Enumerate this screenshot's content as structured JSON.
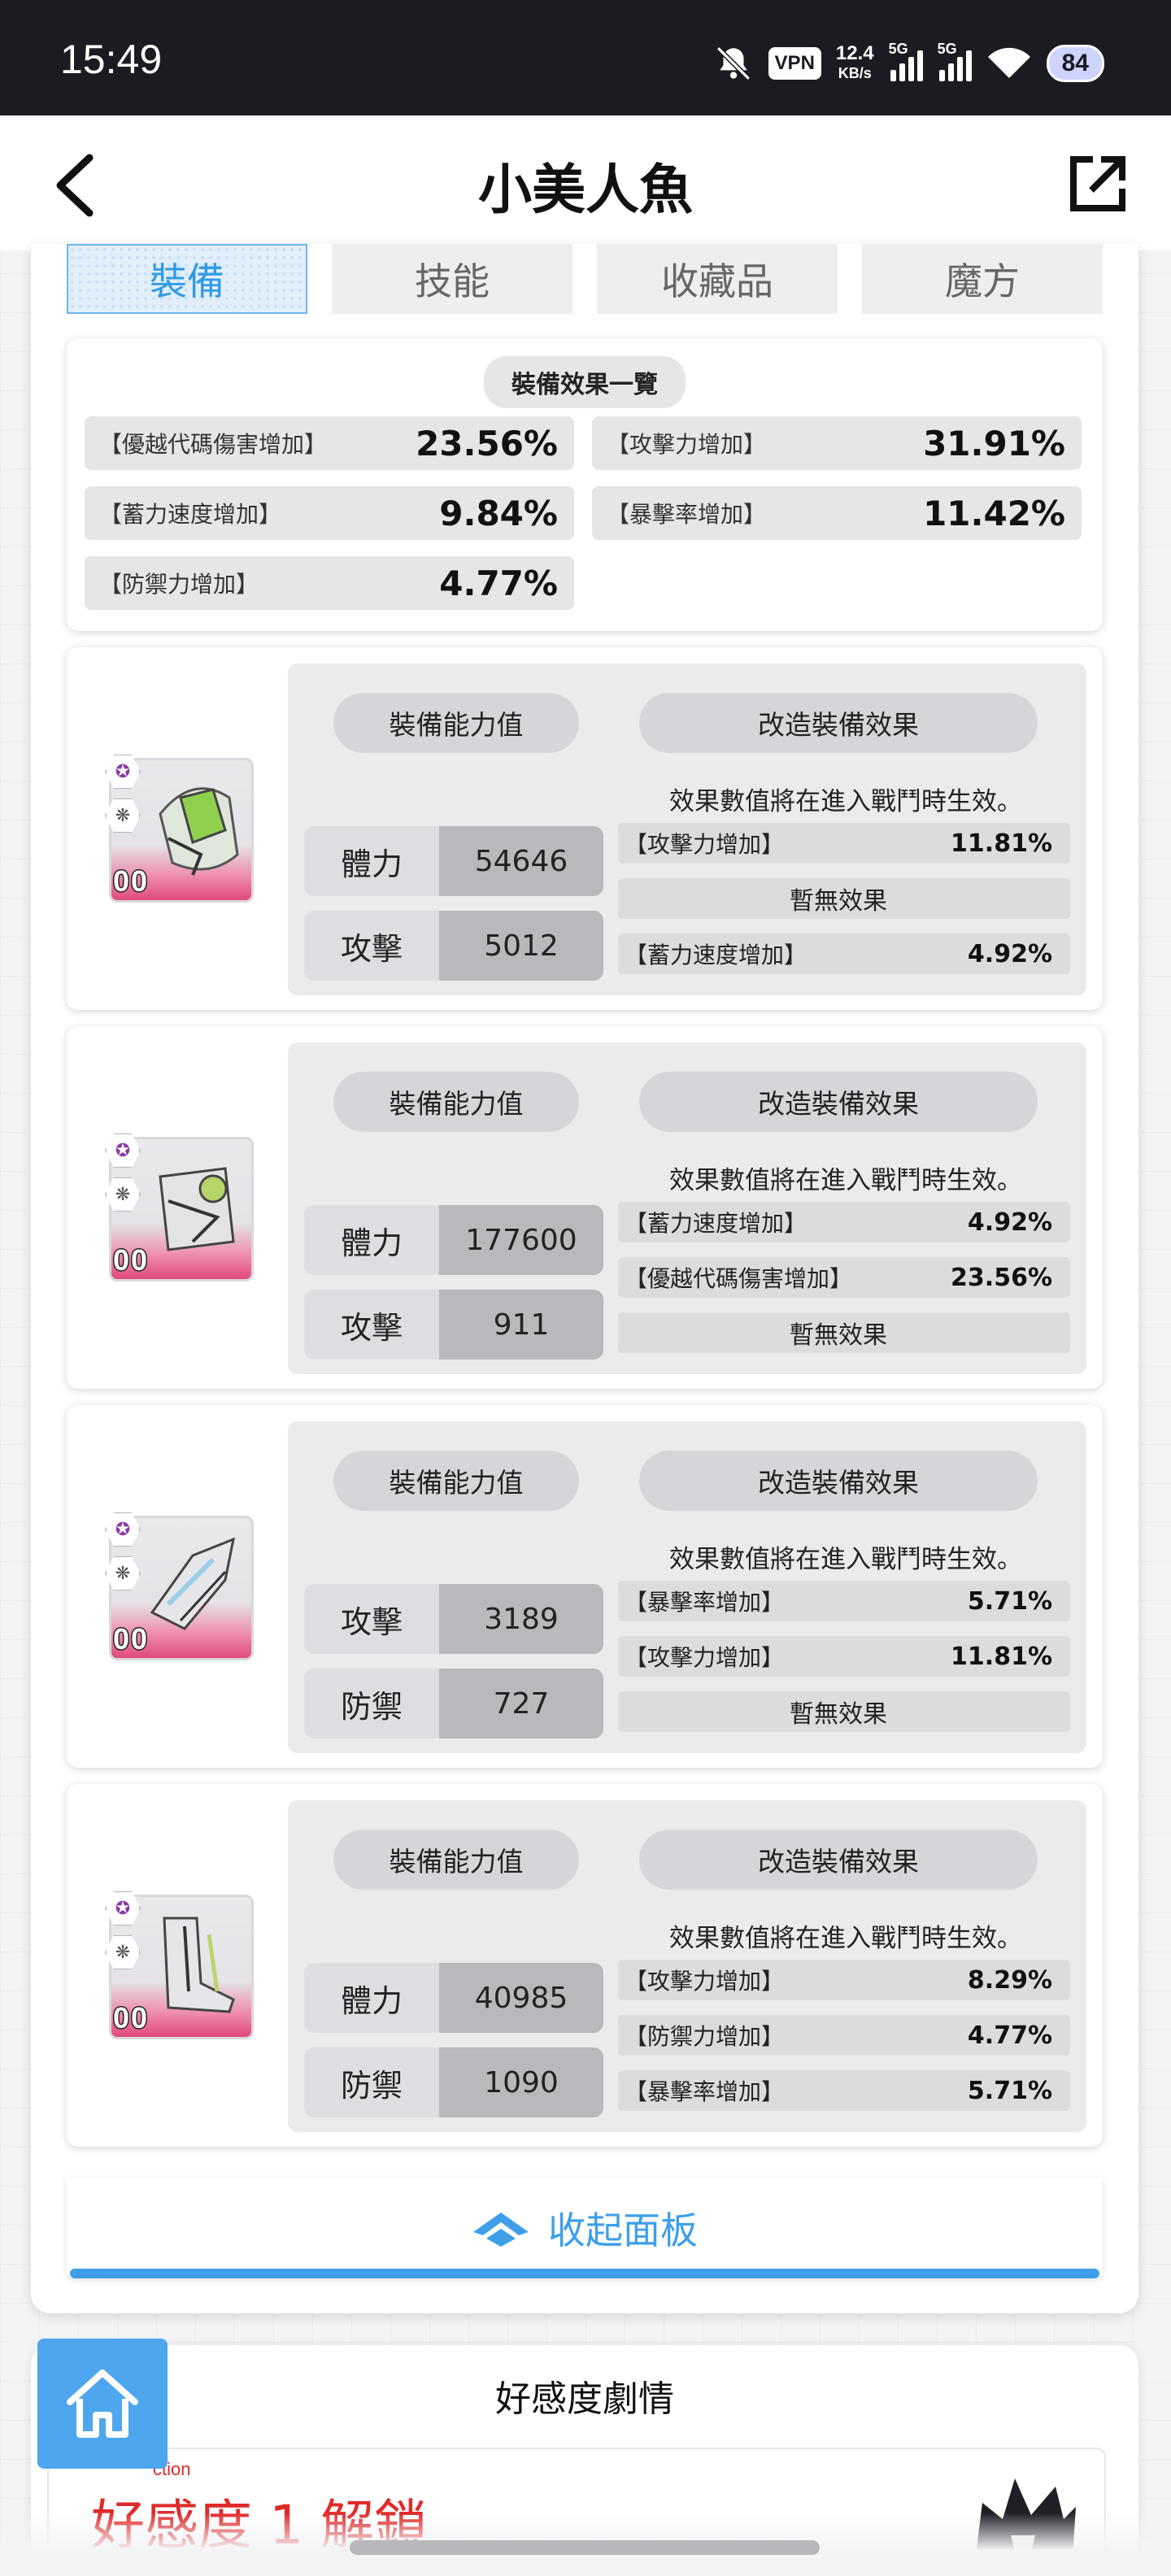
{
  "status_bar": {
    "time": "15:49",
    "vpn": "VPN",
    "speed_value": "12.4",
    "speed_unit": "KB/s",
    "net1": "5G",
    "net2": "5G",
    "battery": "84"
  },
  "header": {
    "title": "小美人魚",
    "back_icon": "chevron-left-icon",
    "share_icon": "external-link-icon"
  },
  "tabs": [
    {
      "label": "裝備",
      "active": true
    },
    {
      "label": "技能",
      "active": false
    },
    {
      "label": "收藏品",
      "active": false
    },
    {
      "label": "魔方",
      "active": false
    }
  ],
  "summary": {
    "title": "裝備效果一覽",
    "items": [
      {
        "label": "【優越代碼傷害增加】",
        "value": "23.56%"
      },
      {
        "label": "【攻擊力增加】",
        "value": "31.91%"
      },
      {
        "label": "【蓄力速度增加】",
        "value": "9.84%"
      },
      {
        "label": "【暴擊率增加】",
        "value": "11.42%"
      },
      {
        "label": "【防禦力增加】",
        "value": "4.77%"
      }
    ]
  },
  "equipment": [
    {
      "level": "00",
      "stats_header": "裝備能力值",
      "effects_header": "改造裝備效果",
      "note": "效果數值將在進入戰鬥時生效。",
      "stats": [
        {
          "name": "體力",
          "value": "54646"
        },
        {
          "name": "攻擊",
          "value": "5012"
        }
      ],
      "effects": [
        {
          "label": "【攻擊力增加】",
          "value": "11.81%"
        },
        {
          "label": "暫無效果",
          "value": ""
        },
        {
          "label": "【蓄力速度增加】",
          "value": "4.92%"
        }
      ]
    },
    {
      "level": "00",
      "stats_header": "裝備能力值",
      "effects_header": "改造裝備效果",
      "note": "效果數值將在進入戰鬥時生效。",
      "stats": [
        {
          "name": "體力",
          "value": "177600"
        },
        {
          "name": "攻擊",
          "value": "911"
        }
      ],
      "effects": [
        {
          "label": "【蓄力速度增加】",
          "value": "4.92%"
        },
        {
          "label": "【優越代碼傷害增加】",
          "value": "23.56%"
        },
        {
          "label": "暫無效果",
          "value": ""
        }
      ]
    },
    {
      "level": "00",
      "stats_header": "裝備能力值",
      "effects_header": "改造裝備效果",
      "note": "效果數值將在進入戰鬥時生效。",
      "stats": [
        {
          "name": "攻擊",
          "value": "3189"
        },
        {
          "name": "防禦",
          "value": "727"
        }
      ],
      "effects": [
        {
          "label": "【暴擊率增加】",
          "value": "5.71%"
        },
        {
          "label": "【攻擊力增加】",
          "value": "11.81%"
        },
        {
          "label": "暫無效果",
          "value": ""
        }
      ]
    },
    {
      "level": "00",
      "stats_header": "裝備能力值",
      "effects_header": "改造裝備效果",
      "note": "效果數值將在進入戰鬥時生效。",
      "stats": [
        {
          "name": "體力",
          "value": "40985"
        },
        {
          "name": "防禦",
          "value": "1090"
        }
      ],
      "effects": [
        {
          "label": "【攻擊力增加】",
          "value": "8.29%"
        },
        {
          "label": "【防禦力增加】",
          "value": "4.77%"
        },
        {
          "label": "【暴擊率增加】",
          "value": "5.71%"
        }
      ]
    }
  ],
  "collapse": {
    "label": "收起面板"
  },
  "affection": {
    "title": "好感度劇情",
    "tag": "ction",
    "heading": "好感度 1 解鎖"
  },
  "colors": {
    "accent": "#3e9fe8",
    "status_bar": "#1b1c22",
    "pink": "#e04a7c",
    "affection_red": "#e02a2a"
  }
}
